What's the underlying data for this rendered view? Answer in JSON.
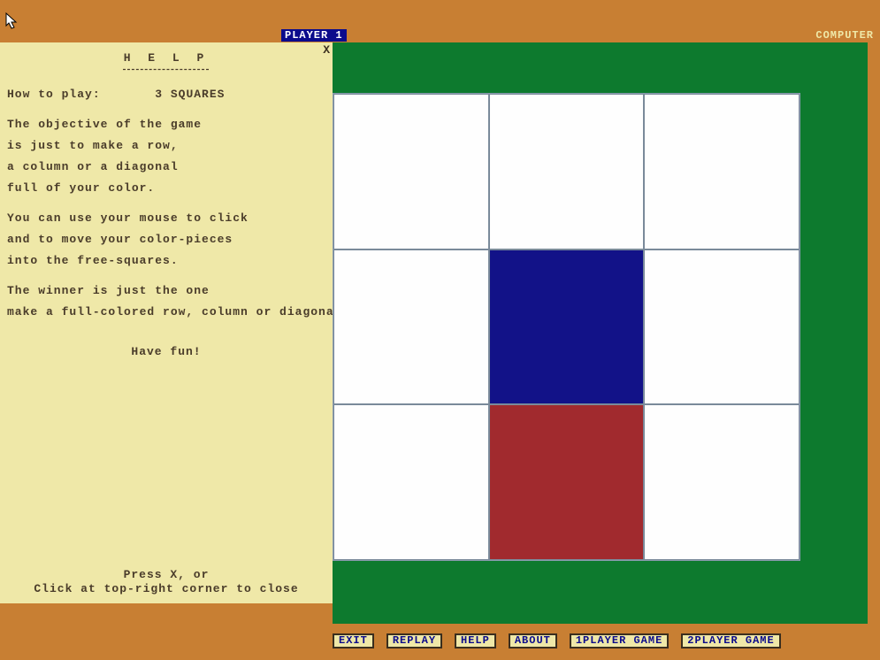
{
  "topbar": {
    "player_label": "PLAYER 1",
    "computer_label": "COMPUTER"
  },
  "help": {
    "close": "X",
    "title": "H E L P",
    "howto_prefix": "How to play:",
    "game_name": "3 SQUARES",
    "lines": [
      "The objective of the game",
      "is just to make a row,",
      "a column or a diagonal",
      "full of your color.",
      "",
      "You can use your mouse to click",
      "and to move your color-pieces",
      "into the free-squares.",
      "",
      "The winner is just the one",
      "make a full-colored row, column or diagonal."
    ],
    "fun": "Have fun!",
    "footer1": "Press X, or",
    "footer2": "Click at top-right corner to close"
  },
  "board": {
    "cells": [
      [
        "white",
        "white",
        "white"
      ],
      [
        "white",
        "blue",
        "white"
      ],
      [
        "white",
        "red",
        "white"
      ]
    ]
  },
  "buttons": {
    "exit": "EXIT",
    "replay": "REPLAY",
    "help": "HELP",
    "about": "ABOUT",
    "one_player": "1PLAYER GAME",
    "two_player": "2PLAYER GAME"
  },
  "colors": {
    "bg": "#c87f33",
    "panel": "#efe8a8",
    "green": "#0d7a2e",
    "blue": "#121288",
    "red": "#a12a2e"
  }
}
